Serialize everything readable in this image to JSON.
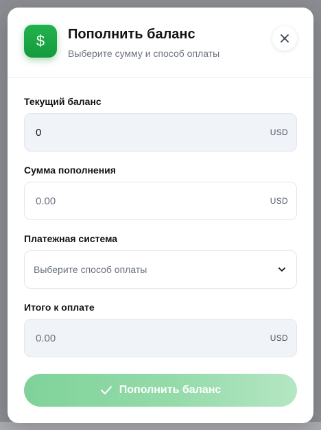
{
  "modal": {
    "title": "Пополнить баланс",
    "subtitle": "Выберите сумму и способ оплаты",
    "icon": "dollar-icon",
    "close_icon": "close-icon"
  },
  "fields": {
    "current_balance": {
      "label": "Текущий баланс",
      "value": "0",
      "unit": "USD"
    },
    "topup_amount": {
      "label": "Сумма пополнения",
      "placeholder": "0.00",
      "value": "",
      "unit": "USD"
    },
    "payment_system": {
      "label": "Платежная система",
      "placeholder": "Выберите способ оплаты"
    },
    "total": {
      "label": "Итого к оплате",
      "value": "0.00",
      "unit": "USD"
    }
  },
  "submit": {
    "label": "Пополнить баланс",
    "icon": "check-icon"
  },
  "colors": {
    "accent": "#1aa546",
    "button_gradient_start": "#7fd29a",
    "button_gradient_end": "#b4e6c3"
  }
}
